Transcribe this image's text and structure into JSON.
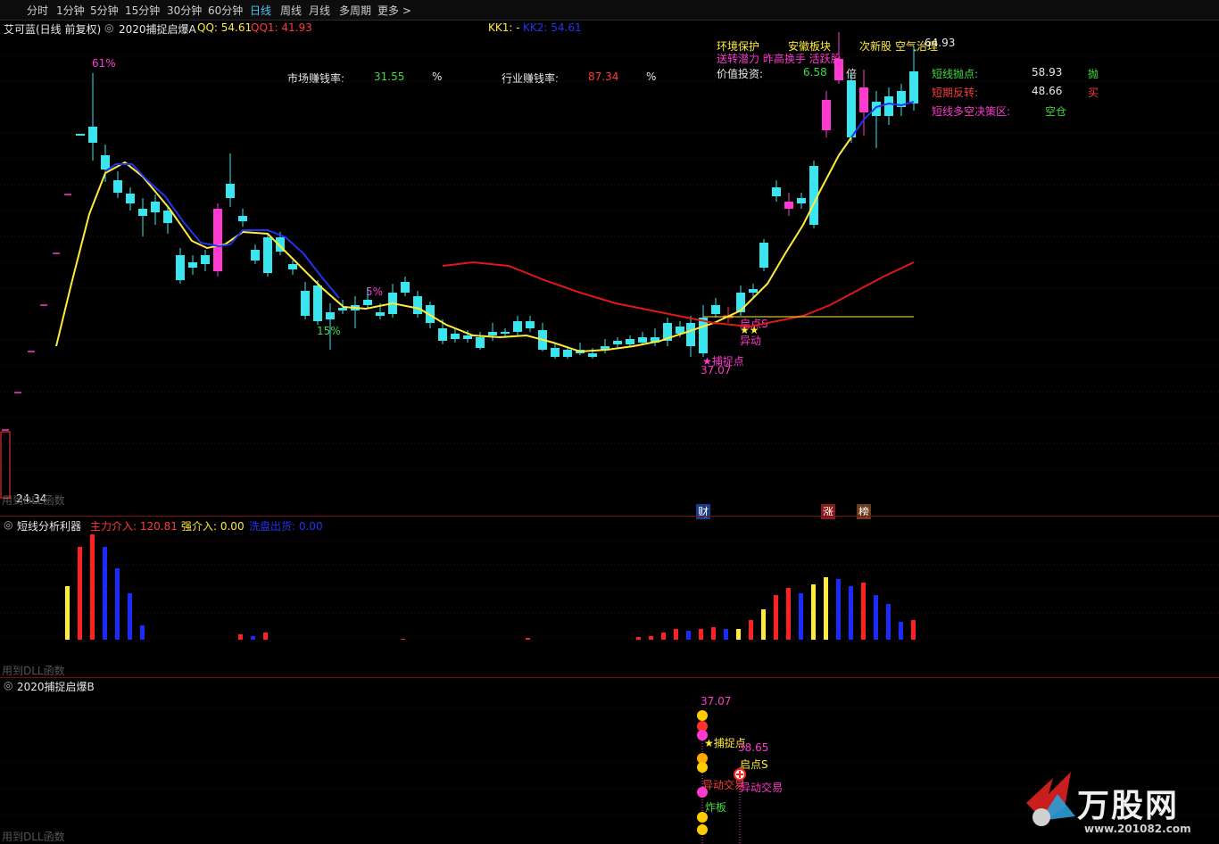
{
  "toolbar": {
    "items": [
      "分时",
      "1分钟",
      "5分钟",
      "15分钟",
      "30分钟",
      "60分钟",
      "日线",
      "周线",
      "月线",
      "多周期",
      "更多 >"
    ],
    "active_index": 6
  },
  "main": {
    "stock_title": "艾可蓝(日线 前复权)",
    "indicator_name": "2020捕捉启爆A",
    "qq": "QQ: 54.61",
    "qq1": "QQ1: 41.93",
    "kk1": "KK1: -",
    "kk2": "KK2: 54.61",
    "market_rate_label": "市场赚钱率:",
    "market_rate_value": "31.55",
    "market_rate_unit": "%",
    "industry_rate_label": "行业赚钱率:",
    "industry_rate_value": "87.34",
    "industry_rate_unit": "%",
    "value_invest_label": "价值投资:",
    "value_invest_value": "6.58",
    "value_invest_tag": "倍",
    "tags_row1": [
      "环境保护",
      "安徽板块",
      "次新股",
      "空气治理"
    ],
    "tags_row2": "送转潜力 昨高换手 活跃股",
    "price_label_top": "64.93",
    "info_rows": [
      {
        "label": "短线抛点:",
        "value": "58.93",
        "action": "抛"
      },
      {
        "label": "短期反转:",
        "value": "48.66",
        "action": "买"
      },
      {
        "label": "短线多空决策区:",
        "value": "空仓",
        "action": ""
      }
    ],
    "pct_labels": [
      "61%",
      "5%",
      "15%"
    ],
    "capture_label": "★捕捉点",
    "capture_price": "37.07",
    "start_label": "启点S",
    "star_label": "★★",
    "abnormal_label": "异动",
    "bottom_price": "24.34",
    "dll_note": "用到DLL函数",
    "markers": [
      "财",
      "涨",
      "榜"
    ]
  },
  "panel2": {
    "name": "短线分析利器",
    "main_in": "主力介入: 120.81",
    "strong_in": "强介入: 0.00",
    "wash_out": "洗盘出货: 0.00",
    "dll_note": "用到DLL函数"
  },
  "panel3": {
    "name": "2020捕捉启爆B",
    "price1": "37.07",
    "capture_label": "★捕捉点",
    "price2": "38.65",
    "start_label": "启点S",
    "abnormal1": "异动交易",
    "abnormal2": "异动交易",
    "zhaban": "炸板",
    "dll_note": "用到DLL函数"
  },
  "watermark": {
    "brand": "万股网",
    "url": "www.201082.com"
  },
  "colors": {
    "up": "#ff3b3b",
    "down": "#39e6f0",
    "yellow": "#ffeb3b",
    "blue": "#2233ee",
    "magenta": "#ff3ad0",
    "green": "#3cdc3c",
    "red_line": "#e01818"
  }
}
